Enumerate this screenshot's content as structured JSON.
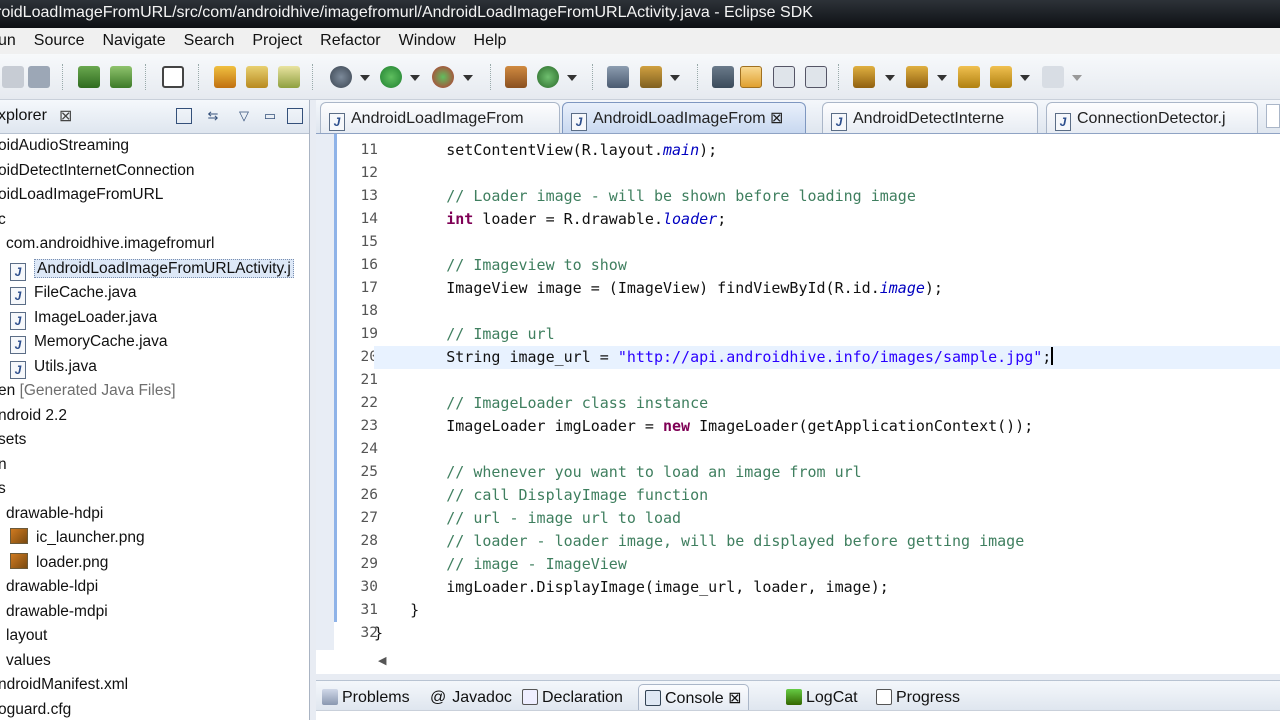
{
  "window": {
    "title": "roidLoadImageFromURL/src/com/androidhive/imagefromurl/AndroidLoadImageFromURLActivity.java - Eclipse SDK"
  },
  "menubar": {
    "items": [
      "un",
      "Source",
      "Navigate",
      "Search",
      "Project",
      "Refactor",
      "Window",
      "Help"
    ]
  },
  "explorer": {
    "title": "xplorer",
    "close": "⊠",
    "items": [
      {
        "label": "oidAudioStreaming",
        "kind": "text"
      },
      {
        "label": "oidDetectInternetConnection",
        "kind": "text"
      },
      {
        "label": "oidLoadImageFromURL",
        "kind": "text"
      },
      {
        "label": "c",
        "kind": "text"
      },
      {
        "label": "com.androidhive.imagefromurl",
        "kind": "package"
      },
      {
        "label": "AndroidLoadImageFromURLActivity.j",
        "kind": "java",
        "selected": true
      },
      {
        "label": "FileCache.java",
        "kind": "java"
      },
      {
        "label": "ImageLoader.java",
        "kind": "java"
      },
      {
        "label": "MemoryCache.java",
        "kind": "java"
      },
      {
        "label": "Utils.java",
        "kind": "java"
      },
      {
        "label": "en",
        "suffix": "[Generated Java Files]",
        "kind": "gen"
      },
      {
        "label": "ndroid 2.2",
        "kind": "text"
      },
      {
        "label": "sets",
        "kind": "text"
      },
      {
        "label": "n",
        "kind": "text"
      },
      {
        "label": "s",
        "kind": "text"
      },
      {
        "label": "drawable-hdpi",
        "kind": "folder-open"
      },
      {
        "label": "ic_launcher.png",
        "kind": "png"
      },
      {
        "label": "loader.png",
        "kind": "png"
      },
      {
        "label": "drawable-ldpi",
        "kind": "folder"
      },
      {
        "label": "drawable-mdpi",
        "kind": "folder"
      },
      {
        "label": "layout",
        "kind": "folder"
      },
      {
        "label": "values",
        "kind": "folder"
      },
      {
        "label": "ndroidManifest.xml",
        "kind": "text"
      },
      {
        "label": "oguard.cfg",
        "kind": "text"
      }
    ]
  },
  "editor_tabs": [
    {
      "label": "AndroidLoadImageFrom",
      "active": false,
      "close": ""
    },
    {
      "label": "AndroidLoadImageFrom",
      "active": true,
      "close": "⊠"
    },
    {
      "label": "AndroidDetectInterne",
      "active": false,
      "close": ""
    },
    {
      "label": "ConnectionDetector.j",
      "active": false,
      "close": ""
    }
  ],
  "editor": {
    "line_numbers": [
      "11",
      "12",
      "13",
      "14",
      "15",
      "16",
      "17",
      "18",
      "19",
      "20",
      "21",
      "22",
      "23",
      "24",
      "25",
      "26",
      "27",
      "28",
      "29",
      "30",
      "31",
      "32"
    ],
    "current_line_index": 9
  },
  "bottom_tabs": [
    {
      "label": "Problems",
      "active": false
    },
    {
      "label": "Javadoc",
      "active": false
    },
    {
      "label": "Declaration",
      "active": false
    },
    {
      "label": "Console",
      "active": true,
      "close": "⊠"
    },
    {
      "label": "LogCat",
      "active": false
    },
    {
      "label": "Progress",
      "active": false
    }
  ],
  "colors": {
    "keyword": "#7f0055",
    "comment": "#3f7f5f",
    "string": "#2a00ff",
    "field": "#0000c0"
  }
}
